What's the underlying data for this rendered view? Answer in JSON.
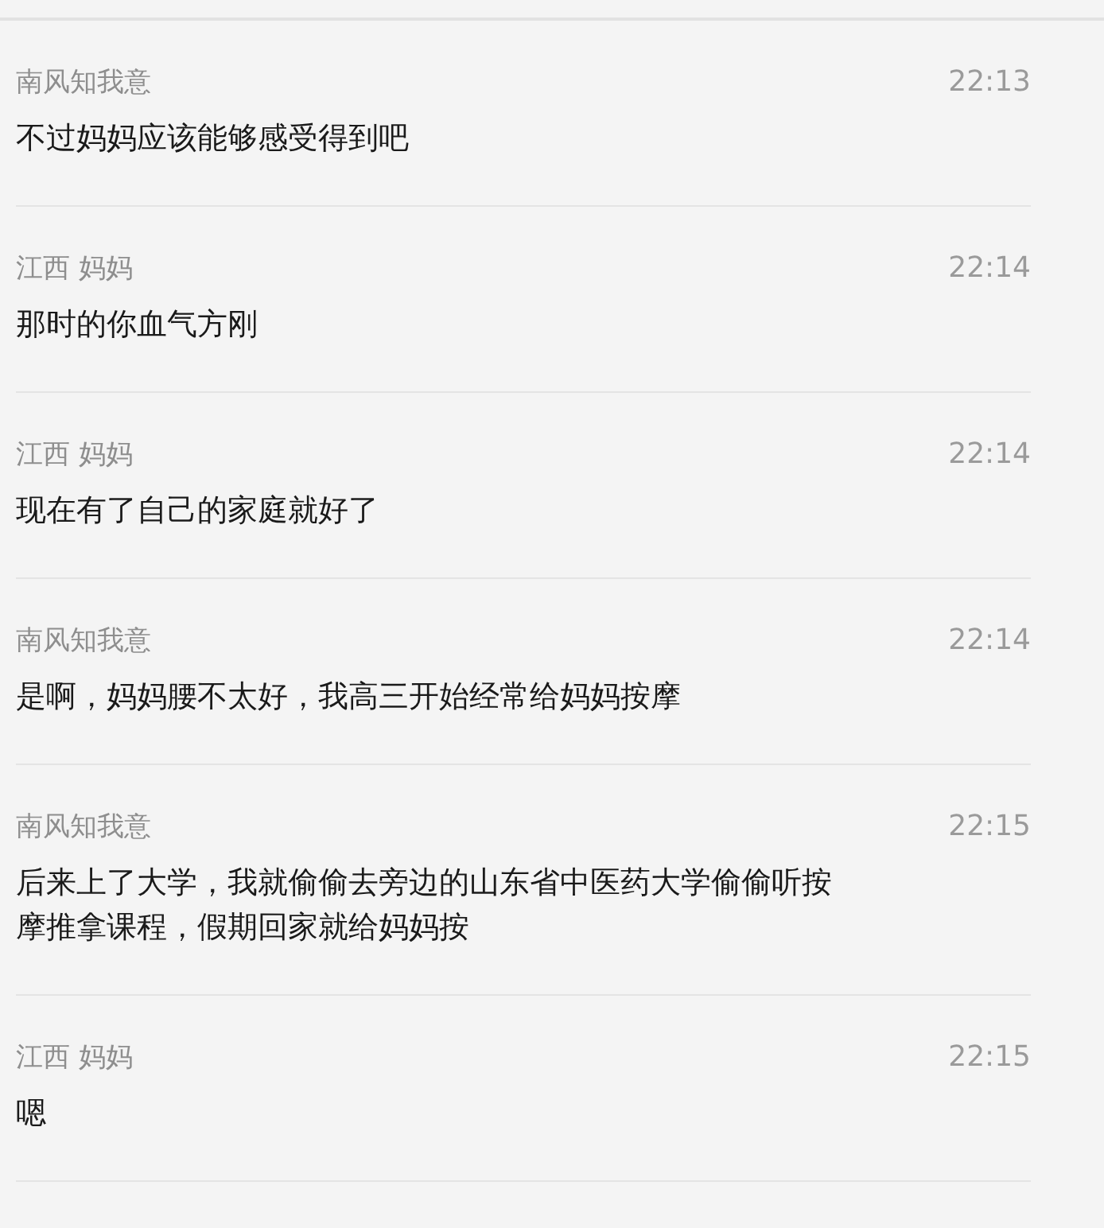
{
  "messages": [
    {
      "sender": "南风知我意",
      "time": "22:13",
      "text": "不过妈妈应该能够感受得到吧"
    },
    {
      "sender": "江西 妈妈",
      "time": "22:14",
      "text": "那时的你血气方刚"
    },
    {
      "sender": "江西 妈妈",
      "time": "22:14",
      "text": "现在有了自己的家庭就好了"
    },
    {
      "sender": "南风知我意",
      "time": "22:14",
      "text": "是啊，妈妈腰不太好，我高三开始经常给妈妈按摩"
    },
    {
      "sender": "南风知我意",
      "time": "22:15",
      "text": "后来上了大学，我就偷偷去旁边的山东省中医药大学偷偷听按摩推拿课程，假期回家就给妈妈按"
    },
    {
      "sender": "江西 妈妈",
      "time": "22:15",
      "text": "嗯"
    }
  ]
}
